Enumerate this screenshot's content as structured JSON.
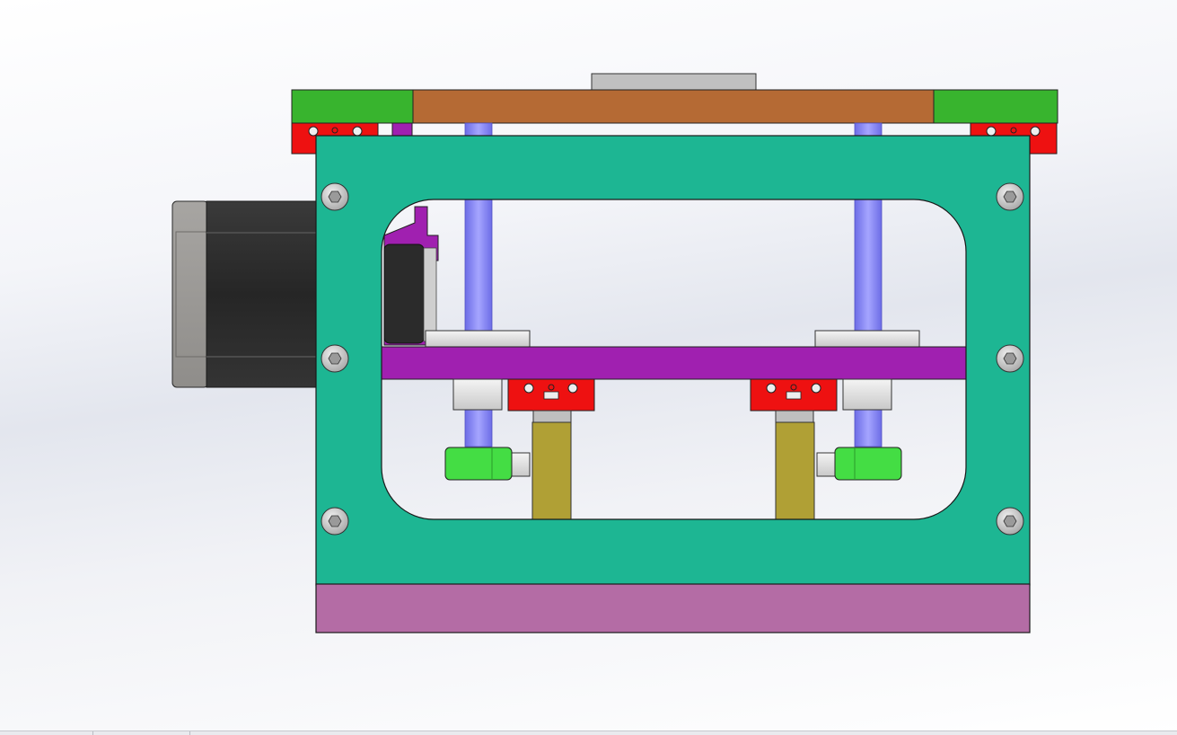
{
  "viewport": {
    "background_top": "#ffffff",
    "background_mid": "#e3e6ee"
  },
  "model": {
    "colors": {
      "frame": "#1db693",
      "base_plate": "#b46ca5",
      "top_plate": "#b56a34",
      "top_side_blocks": "#38b42e",
      "top_cap": "#c0c0c0",
      "rail_carriages": "#ee1111",
      "lead_screws": "#8484f4",
      "moving_platform": "#a020b0",
      "motor_body": "#2d2d2d",
      "motor_end_cap": "#9a9895",
      "shaft_supports": "#b0a035",
      "knobs": "#44dd44",
      "fasteners": "#cfcfcf"
    }
  }
}
